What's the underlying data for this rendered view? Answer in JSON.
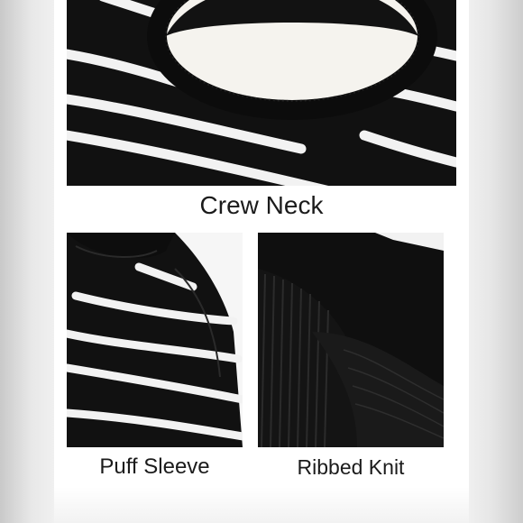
{
  "panels": [
    {
      "id": "crew",
      "caption": "Crew Neck",
      "image": "striped-sweater-crew-neck-photo"
    },
    {
      "id": "puff",
      "caption": "Puff Sleeve",
      "image": "striped-sweater-puff-sleeve-photo"
    },
    {
      "id": "rib",
      "caption": "Ribbed Knit",
      "image": "black-ribbed-knit-hem-photo"
    }
  ],
  "colors": {
    "knit_black": "#111111",
    "stripe_white": "#f4f4f4",
    "background": "#ffffff"
  }
}
